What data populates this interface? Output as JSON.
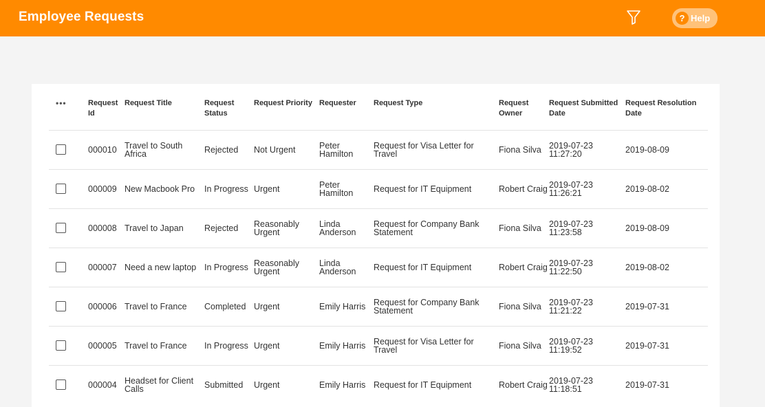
{
  "app": {
    "title": "Employee Requests"
  },
  "toolbar": {
    "filter_icon": "filter-icon",
    "help_mark": "?",
    "help_label": "Help"
  },
  "colors": {
    "header_bg": "#ff8a00",
    "help_bg": "#ffc27a",
    "page_bg": "#f4f4f4"
  },
  "table": {
    "menu_label": "•••",
    "columns": [
      "Request Id",
      "Request Title",
      "Request Status",
      "Request Priority",
      "Requester",
      "Request Type",
      "Request Owner",
      "Request Submitted Date",
      "Request Resolution Date"
    ],
    "rows": [
      {
        "id": "000010",
        "title": "Travel to South Africa",
        "status": "Rejected",
        "priority": "Not Urgent",
        "requester": "Peter Hamilton",
        "type": "Request for Visa Letter for Travel",
        "owner": "Fiona Silva",
        "submitted": "2019-07-23 11:27:20",
        "resolution": "2019-08-09"
      },
      {
        "id": "000009",
        "title": "New Macbook Pro",
        "status": "In Progress",
        "priority": "Urgent",
        "requester": "Peter Hamilton",
        "type": "Request for IT Equipment",
        "owner": "Robert Craig",
        "submitted": "2019-07-23 11:26:21",
        "resolution": "2019-08-02"
      },
      {
        "id": "000008",
        "title": "Travel to Japan",
        "status": "Rejected",
        "priority": "Reasonably Urgent",
        "requester": "Linda Anderson",
        "type": "Request for Company Bank Statement",
        "owner": "Fiona Silva",
        "submitted": "2019-07-23 11:23:58",
        "resolution": "2019-08-09"
      },
      {
        "id": "000007",
        "title": "Need a new laptop",
        "status": "In Progress",
        "priority": "Reasonably Urgent",
        "requester": "Linda Anderson",
        "type": "Request for IT Equipment",
        "owner": "Robert Craig",
        "submitted": "2019-07-23 11:22:50",
        "resolution": "2019-08-02"
      },
      {
        "id": "000006",
        "title": "Travel to France",
        "status": "Completed",
        "priority": "Urgent",
        "requester": "Emily Harris",
        "type": "Request for Company Bank Statement",
        "owner": "Fiona Silva",
        "submitted": "2019-07-23 11:21:22",
        "resolution": "2019-07-31"
      },
      {
        "id": "000005",
        "title": "Travel to France",
        "status": "In Progress",
        "priority": "Urgent",
        "requester": "Emily Harris",
        "type": "Request for Visa Letter for Travel",
        "owner": "Fiona Silva",
        "submitted": "2019-07-23 11:19:52",
        "resolution": "2019-07-31"
      },
      {
        "id": "000004",
        "title": "Headset for Client Calls",
        "status": "Submitted",
        "priority": "Urgent",
        "requester": "Emily Harris",
        "type": "Request for IT Equipment",
        "owner": "Robert Craig",
        "submitted": "2019-07-23 11:18:51",
        "resolution": "2019-07-31"
      }
    ]
  }
}
